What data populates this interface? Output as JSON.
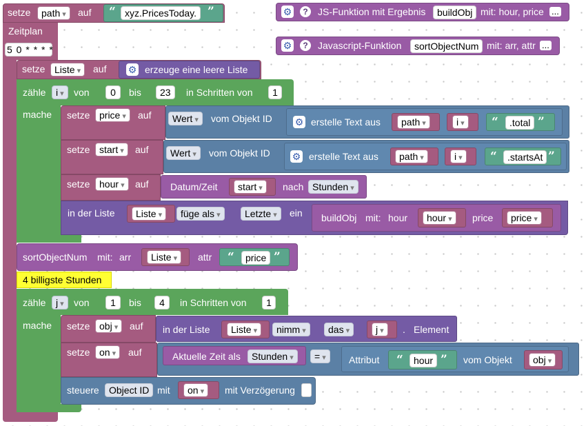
{
  "main": {
    "setze": "setze",
    "auf": "auf",
    "path_var": "path",
    "path_value": "xyz.PricesToday.",
    "zeitplan": "Zeitplan",
    "cron": "5 0 * * * *"
  },
  "functions": {
    "js_label": "JS-Funktion mit Ergebnis",
    "js_name": "buildObj",
    "js_params": "mit: hour, price",
    "javascript_label": "Javascript-Funktion",
    "javascript_name": "sortObjectNum",
    "javascript_params": "mit: arr, attr",
    "more": "..."
  },
  "liste_block": {
    "var": "Liste",
    "create_label": "erzeuge eine leere Liste"
  },
  "loop1": {
    "count": "zähle",
    "var": "i",
    "from": "von",
    "from_val": "0",
    "to": "bis",
    "to_val": "23",
    "step": "in Schritten von",
    "step_val": "1",
    "do": "mache"
  },
  "price_row": {
    "var": "price",
    "wert": "Wert",
    "vom_objekt": "vom Objekt ID",
    "create_text": "erstelle Text aus",
    "path": "path",
    "i": "i",
    "suffix": ".total"
  },
  "start_row": {
    "var": "start",
    "wert": "Wert",
    "vom_objekt": "vom Objekt ID",
    "create_text": "erstelle Text aus",
    "path": "path",
    "i": "i",
    "suffix": ".startsAt"
  },
  "hour_row": {
    "var": "hour",
    "datum": "Datum/Zeit",
    "start": "start",
    "nach": "nach",
    "unit": "Stunden"
  },
  "list_add": {
    "in_der_liste": "in der Liste",
    "liste": "Liste",
    "fuege_als": "füge als",
    "letzte": "Letzte",
    "ein": "ein",
    "fn": "buildObj",
    "mit": "mit:",
    "hour_label": "hour",
    "hour_var": "hour",
    "price_label": "price",
    "price_var": "price"
  },
  "sort_call": {
    "fn": "sortObjectNum",
    "mit": "mit:",
    "arr": "arr",
    "liste": "Liste",
    "attr": "attr",
    "attr_val": "price"
  },
  "comment": "4 billigste Stunden",
  "loop2": {
    "count": "zähle",
    "var": "j",
    "from": "von",
    "from_val": "1",
    "to": "bis",
    "to_val": "4",
    "step": "in Schritten von",
    "step_val": "1",
    "do": "mache"
  },
  "obj_row": {
    "var": "obj",
    "in_der_liste": "in der Liste",
    "liste": "Liste",
    "nimm": "nimm",
    "das": "das",
    "j": "j",
    "dot": ".",
    "element": "Element"
  },
  "on_row": {
    "var": "on",
    "aktuelle": "Aktuelle Zeit als",
    "unit": "Stunden",
    "op": "=",
    "attribut": "Attribut",
    "hour": "hour",
    "vom_objekt": "vom Objekt",
    "obj": "obj"
  },
  "steuere_row": {
    "steuere": "steuere",
    "object_id": "Object ID",
    "mit": "mit",
    "on": "on",
    "delay": "mit Verzögerung"
  }
}
